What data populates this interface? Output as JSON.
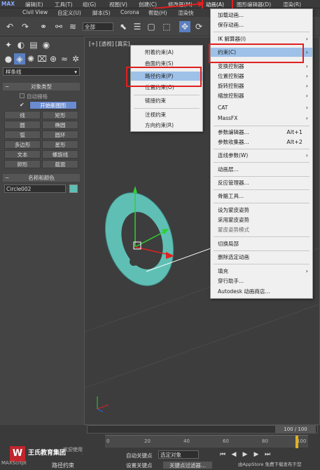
{
  "menubar": {
    "row1": [
      "编辑(E)",
      "工具(T)",
      "组(G)",
      "视图(V)",
      "创建(C)",
      "修改器(M)",
      "动画(A)",
      "图形编辑器(D)",
      "渲染(R)"
    ],
    "row2": [
      "Civil View",
      "自定义(U)",
      "脚本(S)",
      "Corona",
      "帮助(H)",
      "渲染快"
    ],
    "logo": "MAX"
  },
  "toolbar": {
    "selection_filter": "全部"
  },
  "viewport_label": "[+] [透视] [真实]",
  "left_panel": {
    "category_dropdown": "样条线",
    "rollout_object_type": "对象类型",
    "auto_grid": "自动栅格",
    "start_new_shape": "开始新图形",
    "buttons": [
      "线",
      "矩形",
      "圆",
      "椭圆",
      "弧",
      "圆环",
      "多边形",
      "星形",
      "文本",
      "螺旋线",
      "卵形",
      "截面"
    ],
    "rollout_name_color": "名称和颜色",
    "object_name": "Circle002",
    "object_color": "#5fbfb5"
  },
  "animation_menu": {
    "items": [
      {
        "label": "加载动画...",
        "shortcut": "",
        "sub": false
      },
      {
        "label": "保存动画...",
        "shortcut": "",
        "sub": false
      },
      {
        "label": "IK 解算器(I)",
        "shortcut": "",
        "sub": true
      },
      {
        "label": "约束(C)",
        "shortcut": "",
        "sub": true,
        "highlight": true
      },
      {
        "label": "变换控制器",
        "shortcut": "",
        "sub": true
      },
      {
        "label": "位置控制器",
        "shortcut": "",
        "sub": true
      },
      {
        "label": "旋转控制器",
        "shortcut": "",
        "sub": true
      },
      {
        "label": "缩放控制器",
        "shortcut": "",
        "sub": true
      },
      {
        "label": "CAT",
        "shortcut": "",
        "sub": true
      },
      {
        "label": "MassFX",
        "shortcut": "",
        "sub": true
      },
      {
        "label": "参数编辑器...",
        "shortcut": "Alt+1",
        "sub": false
      },
      {
        "label": "参数收集器...",
        "shortcut": "Alt+2",
        "sub": false
      },
      {
        "label": "连线参数(W)",
        "shortcut": "",
        "sub": true
      },
      {
        "label": "动画层...",
        "shortcut": "",
        "sub": false
      },
      {
        "label": "反应管理器...",
        "shortcut": "",
        "sub": false
      },
      {
        "label": "骨骼工具...",
        "shortcut": "",
        "sub": false
      },
      {
        "label": "设为蒙皮姿势",
        "shortcut": "",
        "sub": false
      },
      {
        "label": "采用蒙皮姿势",
        "shortcut": "",
        "sub": false
      },
      {
        "label": "蒙皮姿势模式",
        "shortcut": "",
        "sub": false
      },
      {
        "label": "切换局部",
        "shortcut": "",
        "sub": false
      },
      {
        "label": "删除选定动画",
        "shortcut": "",
        "sub": false
      },
      {
        "label": "填充",
        "shortcut": "",
        "sub": true
      },
      {
        "label": "穿行助手...",
        "shortcut": "",
        "sub": false
      },
      {
        "label": "Autodesk 动画商店...",
        "shortcut": "",
        "sub": false
      }
    ]
  },
  "constraint_submenu": {
    "items": [
      "附着约束(A)",
      "曲面约束(S)",
      "路径约束(P)",
      "位置约束(O)",
      "链接约束",
      "注视约束",
      "方向约束(R)"
    ]
  },
  "timeline": {
    "frame_counter": "100 / 100",
    "ticks": [
      "0",
      "20",
      "40",
      "60",
      "80",
      "100"
    ],
    "auto_key": "自动关键点",
    "selected_object": "选定对象",
    "set_key": "设置关键点",
    "key_filters": "关键点过滤器...",
    "status": "路径约束",
    "welcome": "欢迎使用 MAXScript。",
    "brand": "王氏教育集团",
    "watermark": "由AppStore 免费下载发布于您",
    "maxscript": "MAXScript"
  }
}
